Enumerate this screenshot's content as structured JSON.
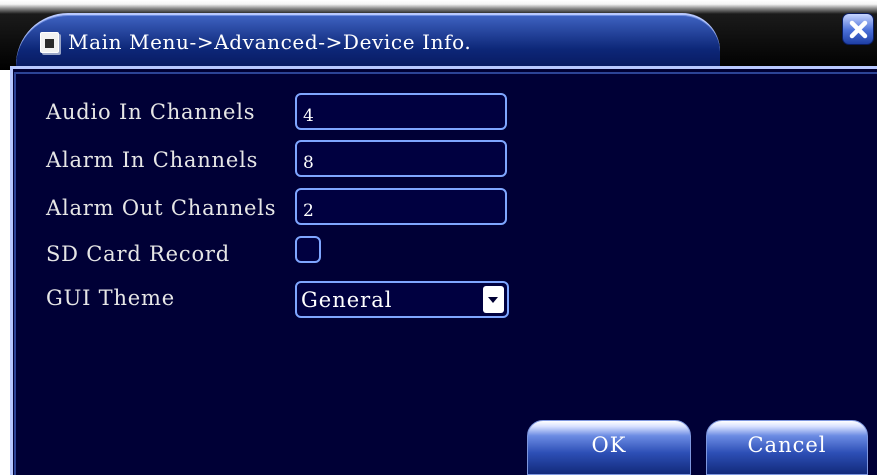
{
  "window": {
    "title": "Main Menu->Advanced->Device Info.",
    "title_icon": "folder-icon",
    "close_icon": "close-icon"
  },
  "form": {
    "audio_in": {
      "label": "Audio In Channels",
      "value": "4"
    },
    "alarm_in": {
      "label": "Alarm In Channels",
      "value": "8"
    },
    "alarm_out": {
      "label": "Alarm Out Channels",
      "value": "2"
    },
    "sd_card": {
      "label": "SD Card Record",
      "checked": false
    },
    "gui_theme": {
      "label": "GUI Theme",
      "value": "General"
    }
  },
  "buttons": {
    "ok": "OK",
    "cancel": "Cancel"
  },
  "colors": {
    "panel_bg": "#000033",
    "field_border": "#7fa6ff",
    "title_tab": "#0d2778",
    "text": "#e6e6e6"
  }
}
